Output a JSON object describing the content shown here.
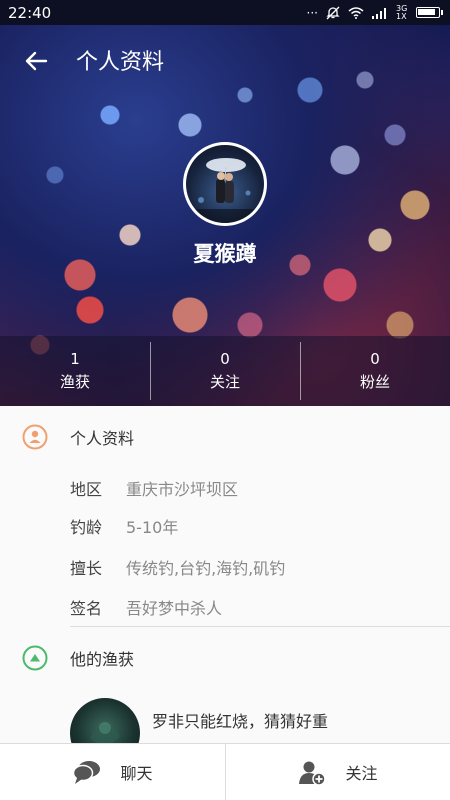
{
  "status_bar": {
    "time": "22:40",
    "network": "3G 1X",
    "battery_level": 0.9
  },
  "header": {
    "title": "个人资料",
    "back_icon": "arrow-left-icon"
  },
  "profile": {
    "name": "夏猴蹲",
    "stats": [
      {
        "value": "1",
        "label": "渔获"
      },
      {
        "value": "0",
        "label": "关注"
      },
      {
        "value": "0",
        "label": "粉丝"
      }
    ]
  },
  "personal_info": {
    "section_title": "个人资料",
    "icon": "person-icon",
    "icon_color": "#f0a070",
    "fields": [
      {
        "key": "地区",
        "value": "重庆市沙坪坝区"
      },
      {
        "key": "钓龄",
        "value": "5-10年"
      },
      {
        "key": "擅长",
        "value": "传统钓,台钓,海钓,矶钓"
      },
      {
        "key": "签名",
        "value": "吾好梦中杀人"
      }
    ]
  },
  "catches": {
    "section_title": "他的渔获",
    "icon": "triangle-up-icon",
    "icon_color": "#4cba6c",
    "items": [
      {
        "text": "罗非只能红烧，猜猜好重"
      }
    ]
  },
  "bottom_bar": {
    "chat_label": "聊天",
    "chat_icon": "chat-bubble-icon",
    "follow_label": "关注",
    "follow_icon": "add-user-icon"
  }
}
